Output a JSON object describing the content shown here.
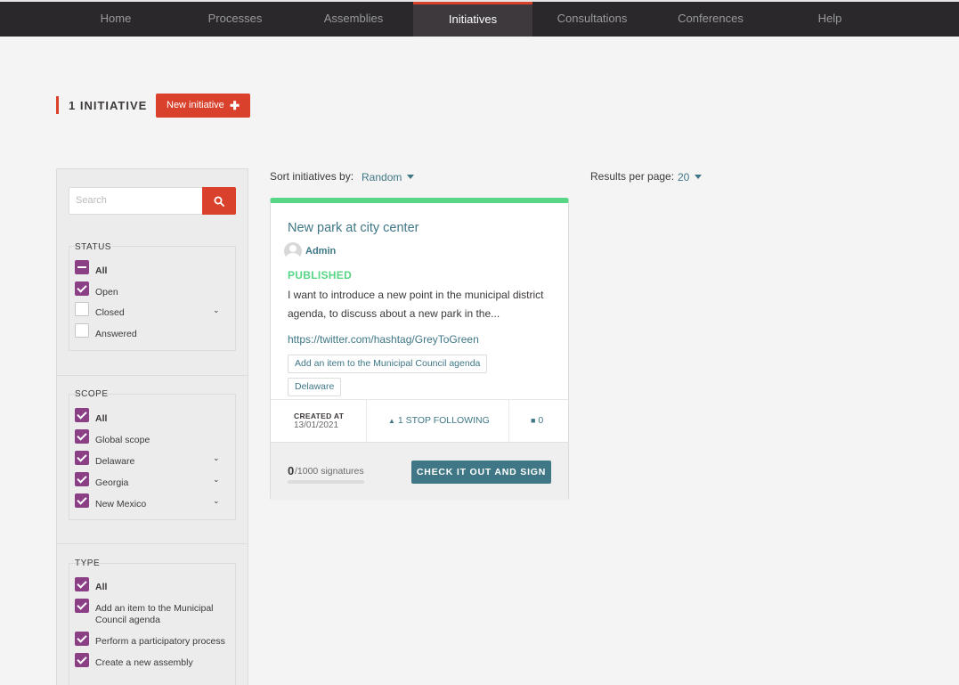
{
  "nav": [
    "Home",
    "Processes",
    "Assemblies",
    "Initiatives",
    "Consultations",
    "Conferences",
    "Help"
  ],
  "nav_active": "Initiatives",
  "heading": "1 INITIATIVE",
  "new_button": "New initiative",
  "search": {
    "placeholder": "Search"
  },
  "filters": {
    "status": {
      "title": "STATUS",
      "options": [
        "All",
        "Open",
        "Closed",
        "Answered"
      ]
    },
    "scope": {
      "title": "SCOPE",
      "options": [
        "All",
        "Global scope",
        "Delaware",
        "Georgia",
        "New Mexico"
      ]
    },
    "type": {
      "title": "TYPE",
      "options": [
        "All",
        "Add an item to the Municipal Council agenda",
        "Perform a participatory process",
        "Create a new assembly"
      ]
    }
  },
  "sort": {
    "label": "Sort initiatives by:",
    "value": "Random"
  },
  "per_page": {
    "label": "Results per page:",
    "value": "20"
  },
  "card": {
    "title": "New park at city center",
    "author": "Admin",
    "status": "PUBLISHED",
    "description": "I want to introduce a new point in the municipal district agenda, to discuss about a new park in the...",
    "link": "https://twitter.com/hashtag/GreyToGreen",
    "tags": [
      "Add an item to the Municipal Council agenda",
      "Delaware"
    ],
    "created_label": "CREATED AT",
    "created_value": "13/01/2021",
    "follow": "1 STOP FOLLOWING",
    "comments": "0",
    "signatures_count": "0",
    "signatures_total": "/1000 signatures",
    "sign_button": "CHECK IT OUT AND SIGN"
  },
  "colors": {
    "accent": "#d9412c",
    "checkbox": "#8b3f85",
    "link": "#3f7786",
    "published": "#57d685",
    "nav_bg": "#2a282b"
  }
}
